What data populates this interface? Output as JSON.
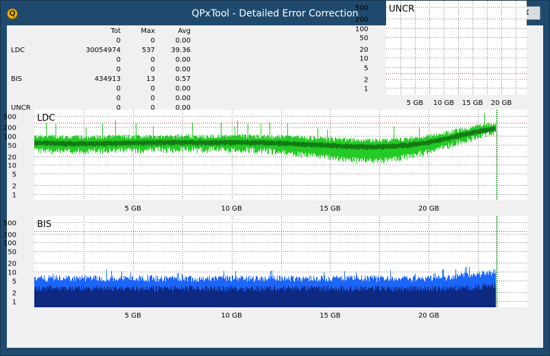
{
  "window": {
    "title": "QPxTool - Detailed Error Correction",
    "app_icon_letter": "Q",
    "close_glyph": "✕"
  },
  "stats_table": {
    "headers": [
      "",
      "Tot",
      "Max",
      "Avg"
    ],
    "rows": [
      [
        "",
        "0",
        "0",
        "0.00"
      ],
      [
        "LDC",
        "30054974",
        "537",
        "39.36"
      ],
      [
        "",
        "0",
        "0",
        "0.00"
      ],
      [
        "",
        "0",
        "0",
        "0.00"
      ],
      [
        "BIS",
        "434913",
        "13",
        "0.57"
      ],
      [
        "",
        "0",
        "0",
        "0.00"
      ],
      [
        "",
        "0",
        "0",
        "0.00"
      ],
      [
        "UNCR",
        "0",
        "0",
        "0.00"
      ]
    ]
  },
  "colors": {
    "ldc_light": "#22cc22",
    "ldc_dark": "#157a15",
    "bis_light": "#1a66ff",
    "bis_dark": "#0d2a80",
    "limit_line": "#cc2222",
    "grid": "#7a7a7a",
    "total_marker": "#1a8a1a"
  },
  "chart_data": [
    {
      "type": "area",
      "title": "UNCR",
      "scale": "log",
      "y_ticks": [
        "500",
        "200",
        "100",
        "50",
        "20",
        "10",
        "5",
        "2",
        "1"
      ],
      "x_ticks": [
        "5 GB",
        "10 GB",
        "15 GB",
        "20 GB"
      ],
      "xlim": [
        0,
        24.4
      ],
      "ylim": [
        0.6,
        800
      ],
      "limit_level": 3,
      "series": [
        {
          "values": []
        }
      ]
    },
    {
      "type": "area",
      "title": "LDC",
      "scale": "log",
      "y_ticks": [
        "500",
        "200",
        "100",
        "50",
        "20",
        "10",
        "5",
        "2",
        "1"
      ],
      "x_ticks": [
        "5 GB",
        "10 GB",
        "15 GB",
        "20 GB"
      ],
      "xlim": [
        0,
        25
      ],
      "ylim": [
        0.6,
        800
      ],
      "limit_level": 280,
      "end_marker_gb": 23.45,
      "x": [
        0,
        1,
        2,
        3,
        4,
        5,
        6,
        7,
        8,
        9,
        10,
        11,
        12,
        13,
        14,
        15,
        16,
        17,
        18,
        19,
        20,
        21,
        22,
        23,
        23.4
      ],
      "series": [
        {
          "name": "max",
          "values": [
            95,
            92,
            90,
            90,
            92,
            94,
            95,
            96,
            95,
            96,
            97,
            96,
            94,
            90,
            85,
            78,
            70,
            68,
            70,
            78,
            95,
            130,
            180,
            240,
            260
          ]
        },
        {
          "name": "avg",
          "values": [
            62,
            60,
            58,
            58,
            60,
            62,
            63,
            64,
            64,
            64,
            64,
            63,
            62,
            58,
            54,
            50,
            46,
            45,
            47,
            52,
            65,
            90,
            130,
            175,
            195
          ]
        },
        {
          "name": "min",
          "values": [
            32,
            30,
            30,
            31,
            32,
            33,
            34,
            34,
            34,
            34,
            34,
            33,
            30,
            26,
            22,
            18,
            15,
            14,
            15,
            20,
            28,
            45,
            75,
            115,
            130
          ]
        }
      ]
    },
    {
      "type": "bar",
      "title": "BIS",
      "scale": "log",
      "y_ticks": [
        "500",
        "200",
        "100",
        "50",
        "20",
        "10",
        "5",
        "2",
        "1"
      ],
      "x_ticks": [
        "5 GB",
        "10 GB",
        "15 GB",
        "20 GB"
      ],
      "xlim": [
        0,
        25
      ],
      "ylim": [
        0.6,
        800
      ],
      "limit_level": 240,
      "end_marker_gb": 23.45,
      "x": [
        0,
        1,
        2,
        3,
        4,
        5,
        6,
        7,
        8,
        9,
        10,
        11,
        12,
        13,
        14,
        15,
        16,
        17,
        18,
        19,
        20,
        21,
        22,
        23,
        23.4
      ],
      "series": [
        {
          "name": "max",
          "values": [
            6,
            6,
            6,
            6,
            6,
            6,
            6,
            6,
            6,
            6,
            6,
            6,
            6,
            6,
            6,
            6,
            6,
            6,
            6,
            6,
            6,
            6.5,
            8,
            9,
            10
          ]
        },
        {
          "name": "avg",
          "values": [
            3,
            3,
            3,
            3,
            3,
            3,
            3,
            3,
            3,
            3,
            3,
            3,
            3,
            3,
            3,
            3,
            3,
            3,
            3,
            3,
            3,
            3,
            3.2,
            3.5,
            4
          ]
        }
      ]
    }
  ]
}
